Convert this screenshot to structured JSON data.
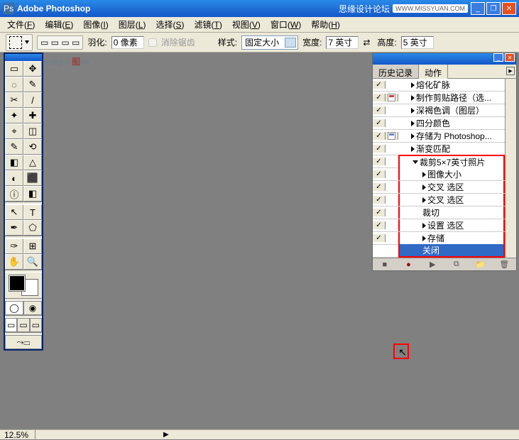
{
  "titlebar": {
    "app_name": "Adobe Photoshop",
    "forum_text": "思缘设计论坛",
    "url_text": "WWW.MISSYUAN.COM"
  },
  "menus": [
    {
      "label": "文件",
      "hk": "F"
    },
    {
      "label": "编辑",
      "hk": "E"
    },
    {
      "label": "图像",
      "hk": "I"
    },
    {
      "label": "图层",
      "hk": "L"
    },
    {
      "label": "选择",
      "hk": "S"
    },
    {
      "label": "滤镜",
      "hk": "T"
    },
    {
      "label": "视图",
      "hk": "V"
    },
    {
      "label": "窗口",
      "hk": "W"
    },
    {
      "label": "帮助",
      "hk": "H"
    }
  ],
  "options": {
    "feather_label": "羽化:",
    "feather_value": "0 像素",
    "antialias_label": "消除锯齿",
    "style_label": "样式:",
    "style_value": "固定大小",
    "width_label": "宽度:",
    "width_value": "7 英寸",
    "height_label": "高度:",
    "height_value": "5 英寸"
  },
  "watermark": {
    "a": "Soft.yesky.c",
    "b": "图",
    "c": "m"
  },
  "actions_panel": {
    "tabs": {
      "history": "历史记录",
      "actions": "动作"
    },
    "rows": [
      {
        "chk": true,
        "dlg": "",
        "indent": 1,
        "tri": "r",
        "label": "熔化矿脉",
        "red": ""
      },
      {
        "chk": true,
        "dlg": "red",
        "indent": 1,
        "tri": "r",
        "label": "制作剪贴路径（选...",
        "red": ""
      },
      {
        "chk": true,
        "dlg": "",
        "indent": 1,
        "tri": "r",
        "label": "深褐色调（图层）",
        "red": ""
      },
      {
        "chk": true,
        "dlg": "",
        "indent": 1,
        "tri": "r",
        "label": "四分颜色",
        "red": ""
      },
      {
        "chk": true,
        "dlg": "blue",
        "indent": 1,
        "tri": "r",
        "label": "存储为 Photoshop...",
        "red": ""
      },
      {
        "chk": true,
        "dlg": "",
        "indent": 1,
        "tri": "r",
        "label": "渐变匹配",
        "red": ""
      },
      {
        "chk": true,
        "dlg": "",
        "indent": 1,
        "tri": "d",
        "label": "裁剪5×7英寸照片",
        "red": "t"
      },
      {
        "chk": true,
        "dlg": "",
        "indent": 2,
        "tri": "r",
        "label": "图像大小",
        "red": "m"
      },
      {
        "chk": true,
        "dlg": "",
        "indent": 2,
        "tri": "r",
        "label": "交叉 选区",
        "red": "m"
      },
      {
        "chk": true,
        "dlg": "",
        "indent": 2,
        "tri": "r",
        "label": "交叉 选区",
        "red": "m"
      },
      {
        "chk": true,
        "dlg": "",
        "indent": 2,
        "tri": "",
        "label": "裁切",
        "red": "m"
      },
      {
        "chk": true,
        "dlg": "",
        "indent": 2,
        "tri": "r",
        "label": "设置 选区",
        "red": "m"
      },
      {
        "chk": true,
        "dlg": "",
        "indent": 2,
        "tri": "r",
        "label": "存储",
        "red": "m"
      },
      {
        "chk": false,
        "dlg": "",
        "indent": 2,
        "tri": "",
        "label": "关闭",
        "red": "b",
        "sel": true
      }
    ],
    "footer_icons": [
      "■",
      "●",
      "▶",
      "⧉",
      "📁",
      "🗑"
    ]
  },
  "statusbar": {
    "zoom": "12.5%"
  },
  "tools": [
    "▭",
    "✥",
    "◌",
    "✎",
    "✂",
    "/",
    "✦",
    "✚",
    "⌖",
    "◫",
    "✎",
    "⟲",
    "◧",
    "△",
    "◐",
    "⬛",
    "ⓘ",
    "◧",
    "↖",
    "T",
    "✒",
    "⬠",
    "✑",
    "⊞",
    "✋",
    "🔍"
  ]
}
